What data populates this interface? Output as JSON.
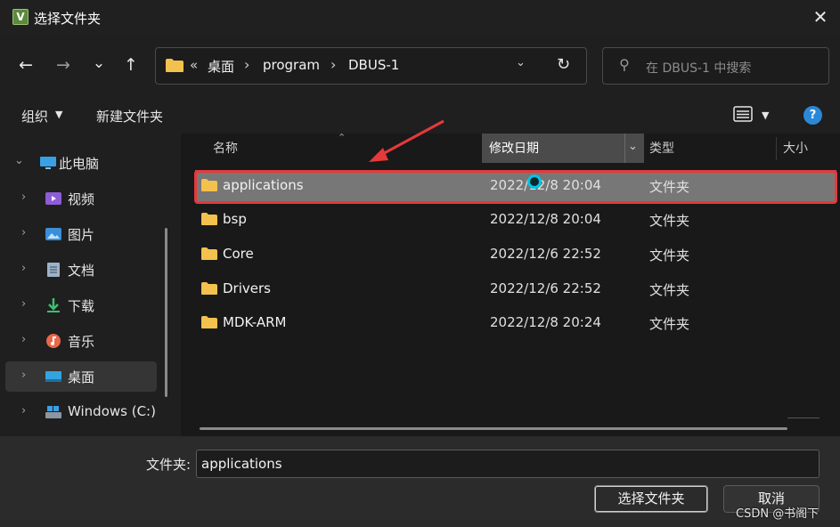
{
  "window": {
    "title": "选择文件夹",
    "close_glyph": "✕",
    "app_icon": "V"
  },
  "nav": {
    "back": "←",
    "forward": "→",
    "recent": "⌄",
    "up": "↑",
    "address": {
      "overflow": "«",
      "crumbs": [
        "桌面",
        "program",
        "DBUS-1"
      ],
      "separator": "›",
      "dropdown": "⌄",
      "refresh": "↻"
    },
    "search": {
      "placeholder": "在 DBUS-1 中搜索"
    }
  },
  "toolbar": {
    "organize": "组织",
    "new_folder": "新建文件夹",
    "help": "?"
  },
  "sidebar": {
    "items": [
      {
        "label": "此电脑",
        "icon": "computer-icon",
        "expanded": true
      },
      {
        "label": "视频",
        "icon": "video-icon"
      },
      {
        "label": "图片",
        "icon": "picture-icon"
      },
      {
        "label": "文档",
        "icon": "document-icon"
      },
      {
        "label": "下载",
        "icon": "download-icon"
      },
      {
        "label": "音乐",
        "icon": "music-icon"
      },
      {
        "label": "桌面",
        "icon": "desktop-icon",
        "selected": true
      },
      {
        "label": "Windows (C:)",
        "icon": "drive-icon"
      }
    ]
  },
  "columns": {
    "name": "名称",
    "date": "修改日期",
    "type": "类型",
    "size": "大小"
  },
  "files": [
    {
      "name": "applications",
      "date": "2022/12/8 20:04",
      "type": "文件夹",
      "selected": true
    },
    {
      "name": "bsp",
      "date": "2022/12/8 20:04",
      "type": "文件夹"
    },
    {
      "name": "Core",
      "date": "2022/12/6 22:52",
      "type": "文件夹"
    },
    {
      "name": "Drivers",
      "date": "2022/12/6 22:52",
      "type": "文件夹"
    },
    {
      "name": "MDK-ARM",
      "date": "2022/12/8 20:24",
      "type": "文件夹"
    }
  ],
  "footer": {
    "folder_label": "文件夹:",
    "folder_value": "applications",
    "select_button": "选择文件夹",
    "cancel_button": "取消",
    "watermark": "CSDN @书阁下"
  },
  "colors": {
    "accent": "#2b88d8",
    "highlight_box": "#e5393b",
    "folder": "#f2c14e",
    "cursor": "#00c6e4"
  }
}
